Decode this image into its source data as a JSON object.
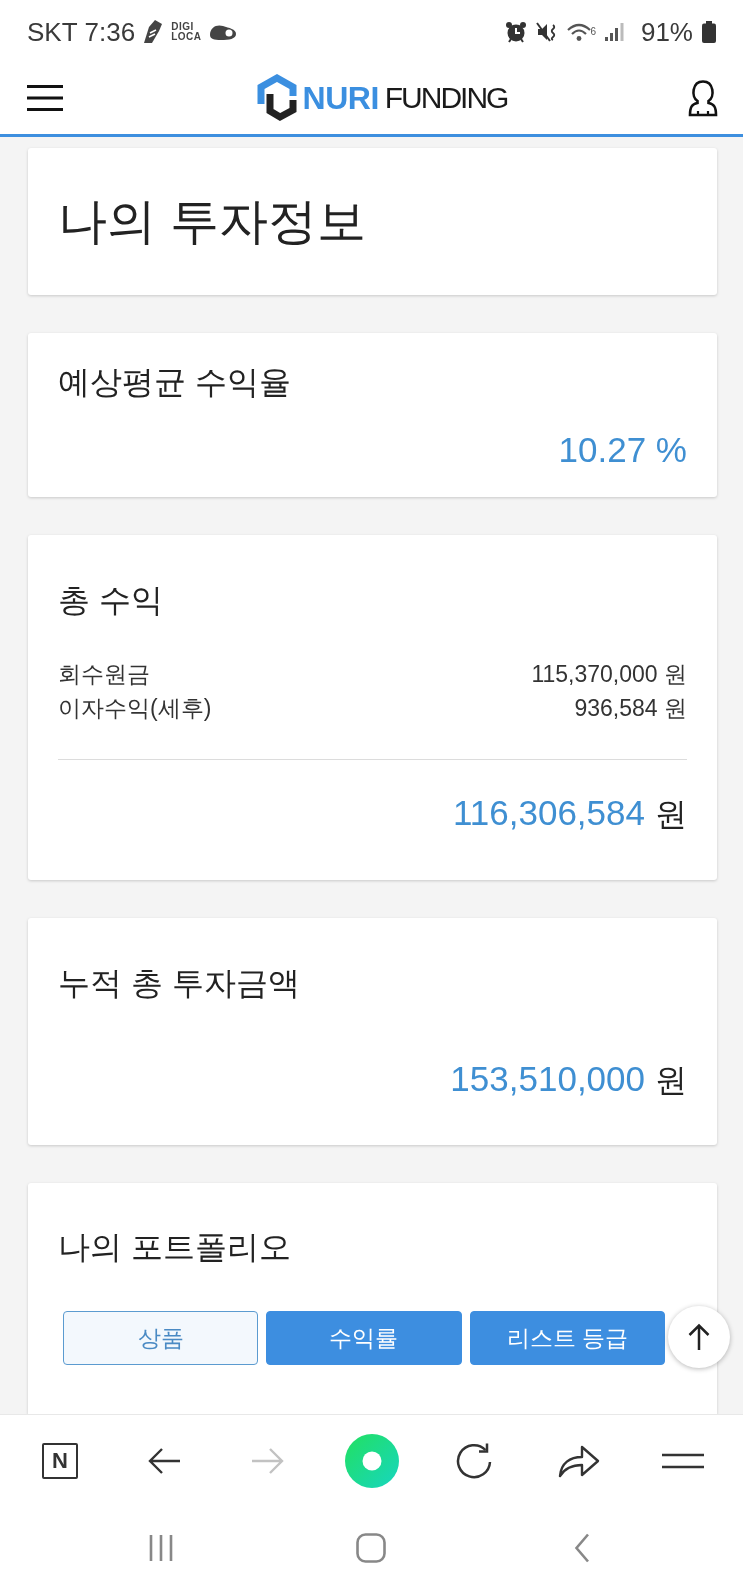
{
  "status_bar": {
    "carrier": "SKT",
    "time": "7:36",
    "notification_label": "DIGI\nLOCA",
    "wifi_label": "6",
    "battery": "91%"
  },
  "header": {
    "logo_primary": "NURI",
    "logo_secondary": "FUNDING"
  },
  "page_title": "나의 투자정보",
  "expected_return": {
    "title": "예상평균 수익율",
    "value": "10.27 %"
  },
  "total_profit": {
    "title": "총 수익",
    "rows": [
      {
        "label": "회수원금",
        "value": "115,370,000 원"
      },
      {
        "label": "이자수익(세후)",
        "value": "936,584 원"
      }
    ],
    "total_amount": "116,306,584",
    "total_unit": "원"
  },
  "cumulative_investment": {
    "title": "누적 총 투자금액",
    "amount": "153,510,000",
    "unit": "원"
  },
  "portfolio": {
    "title": "나의 포트폴리오",
    "tabs": [
      {
        "label": "상품",
        "selected": true
      },
      {
        "label": "수익률",
        "selected": false
      },
      {
        "label": "리스트 등급",
        "selected": false
      }
    ]
  },
  "browser_toolbar": [
    {
      "kind": "home",
      "label": "N",
      "disabled": false
    },
    {
      "kind": "back",
      "disabled": false
    },
    {
      "kind": "forward",
      "disabled": true
    },
    {
      "kind": "ring",
      "disabled": false
    },
    {
      "kind": "reload",
      "disabled": false
    },
    {
      "kind": "share",
      "disabled": false
    },
    {
      "kind": "menu",
      "disabled": false
    }
  ]
}
